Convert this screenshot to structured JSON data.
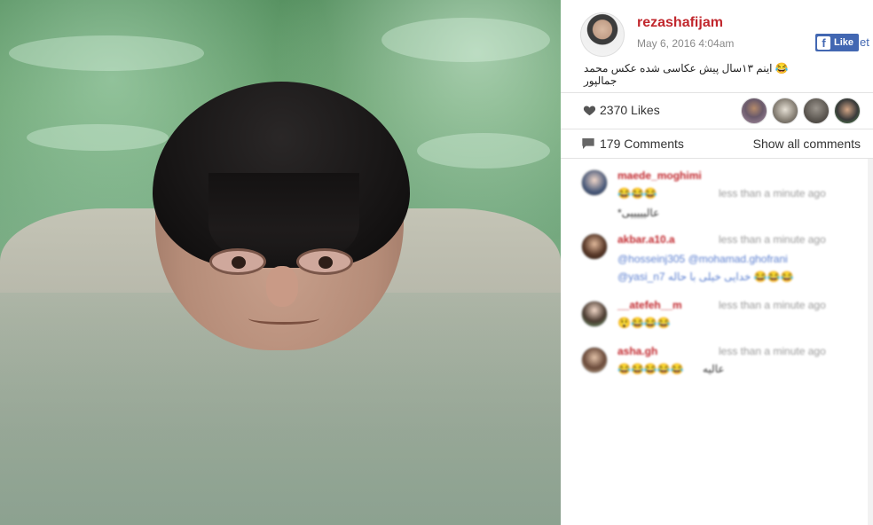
{
  "post": {
    "username": "rezashafijam",
    "date": "May 6, 2016 4:04am",
    "caption": "😂 اینم ۱۳سال پیش عکاسی شده عکس محمد جمالپور",
    "fb_like_label": "Like",
    "fb_cut_text": "et"
  },
  "stats": {
    "likes_text": "2370 Likes",
    "comments_text": "179 Comments",
    "show_all_label": "Show all comments"
  },
  "comments": [
    {
      "user": "maede_moghimi",
      "time": "less than a minute ago",
      "emoji_line": "😂😂😂",
      "text": "*عالیییییی"
    },
    {
      "user": "akbar.a10.a",
      "time": "less than a minute ago",
      "text": "@hosseinj305 @mohamad.ghofrani",
      "text2": "@yasi_n7 خدایی خیلی با حاله 😂😂😂"
    },
    {
      "user": "__atefeh__m",
      "time": "less than a minute ago",
      "emoji_line": "😲😂😂😂"
    },
    {
      "user": "asha.gh",
      "time": "less than a minute ago",
      "emoji_line": "😂😂😂😂😂",
      "text": "عالیه"
    }
  ],
  "colors": {
    "username": "#c1272d",
    "facebook": "#4267b2",
    "mention": "#5b7fd0"
  },
  "icons": [
    "heart-icon",
    "comment-icon",
    "facebook-f-icon"
  ]
}
